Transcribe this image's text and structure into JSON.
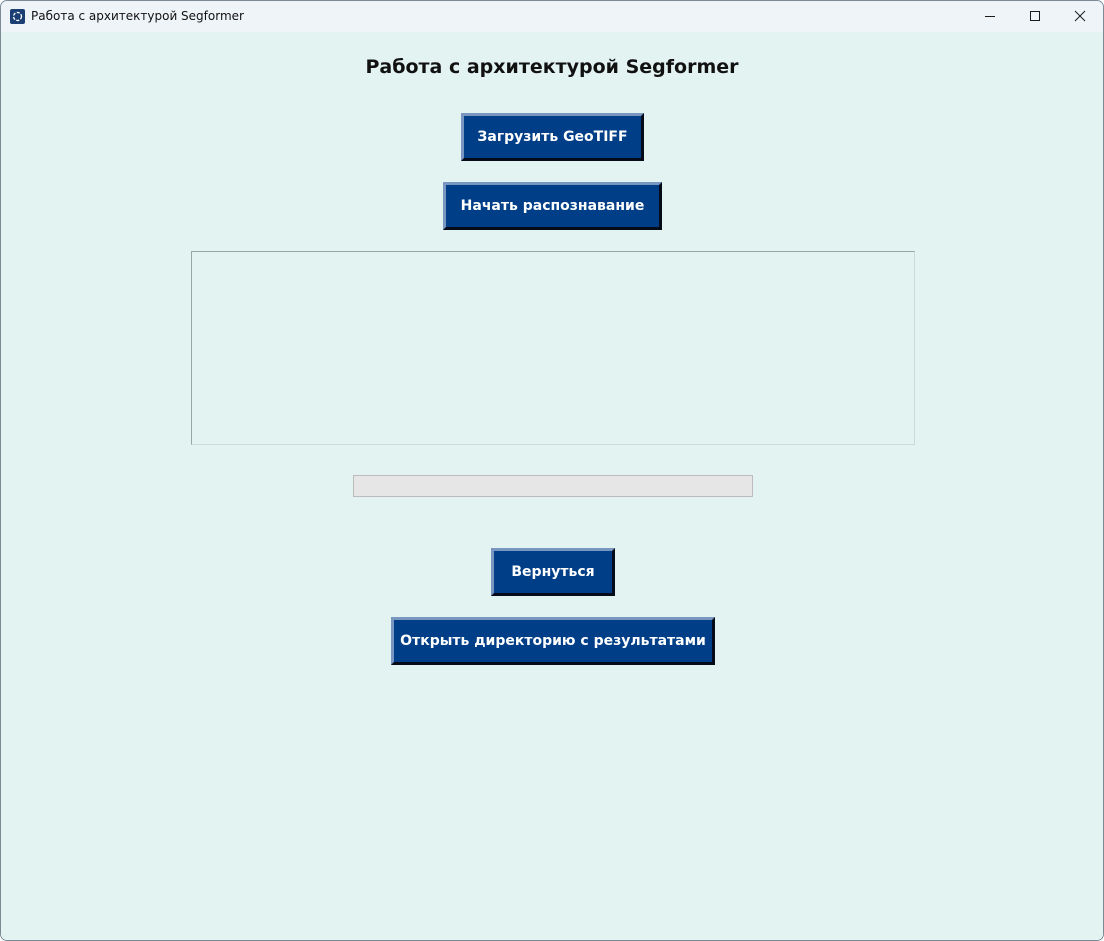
{
  "window": {
    "title": "Работа с архитектурой Segformer"
  },
  "main": {
    "heading": "Работа с архитектурой Segformer",
    "upload_button": "Загрузить GeoTIFF",
    "start_button": "Начать распознавание",
    "log_text": "",
    "progress": 0,
    "back_button": "Вернуться",
    "open_results_button": "Открыть директорию с результатами"
  },
  "colors": {
    "background": "#e2f3f1",
    "button": "#003f87",
    "button_text": "#ffffff"
  },
  "icons": {
    "app": "app-icon",
    "minimize": "minimize-icon",
    "maximize": "maximize-icon",
    "close": "close-icon"
  }
}
